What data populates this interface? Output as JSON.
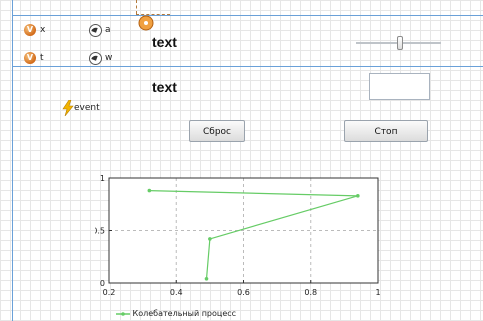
{
  "variables": [
    {
      "badge": "V",
      "label": "x"
    },
    {
      "badge": "V",
      "label": "t"
    }
  ],
  "parameters": [
    {
      "label": "a"
    },
    {
      "label": "w"
    }
  ],
  "texts": {
    "text1": "text",
    "text2": "text"
  },
  "event": {
    "label": "event"
  },
  "buttons": {
    "reset": "Сброс",
    "stop": "Стоп"
  },
  "colors": {
    "series": "#66cc66",
    "accent": "#6aa0d8",
    "badge": "#d26b1a"
  },
  "chart_data": {
    "type": "line",
    "series": [
      {
        "name": "Колебательный процесс",
        "points": [
          [
            0.49,
            0.04
          ],
          [
            0.5,
            0.42
          ],
          [
            0.94,
            0.83
          ],
          [
            0.32,
            0.88
          ]
        ]
      }
    ],
    "xlim": [
      0.2,
      1.0
    ],
    "ylim": [
      0,
      1
    ],
    "xticks": [
      "0.2",
      "0.4",
      "0.6",
      "0.8",
      "1"
    ],
    "yticks": [
      "0",
      "0.5",
      "1"
    ],
    "grid": true,
    "legend_position": "bottom"
  }
}
